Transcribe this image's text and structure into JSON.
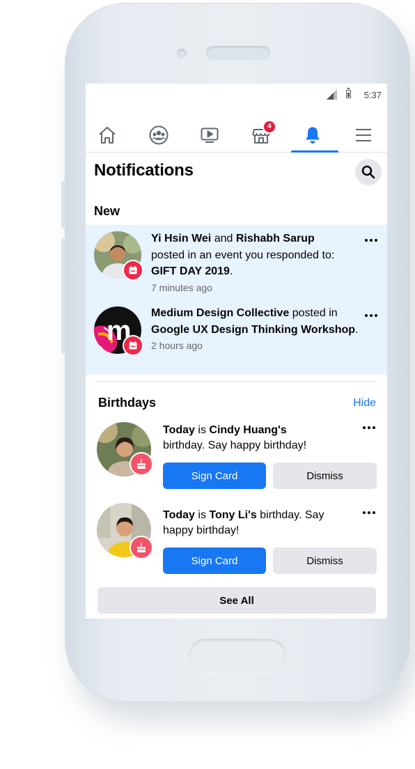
{
  "status_bar": {
    "time": "5:37"
  },
  "nav": {
    "items": [
      "home",
      "groups",
      "watch",
      "marketplace",
      "notifications",
      "menu"
    ],
    "marketplace_badge": "4",
    "active": "notifications"
  },
  "header": {
    "title": "Notifications"
  },
  "sections": {
    "new_label": "New"
  },
  "notifications": [
    {
      "actor1": "Yi Hsin Wei",
      "connector": " and ",
      "actor2": "Rishabh Sarup",
      "action": "posted in an event you responded to:",
      "target": "GIFT DAY 2019",
      "suffix": ".",
      "time": "7 minutes ago"
    },
    {
      "actor1": "Medium Design Collective",
      "action": " posted in",
      "target": "Google UX Design Thinking Workshop",
      "suffix": ".",
      "time": "2 hours ago"
    }
  ],
  "birthdays": {
    "title": "Birthdays",
    "hide_label": "Hide",
    "items": [
      {
        "today": "Today",
        "is": " is ",
        "name": "Cindy Huang's",
        "rest": "birthday. Say happy birthday!",
        "sign_label": "Sign Card",
        "dismiss_label": "Dismiss"
      },
      {
        "today": "Today",
        "is": " is ",
        "name": "Tony Li's",
        "rest": " birthday. Say happy birthday!",
        "sign_label": "Sign Card",
        "dismiss_label": "Dismiss"
      }
    ],
    "see_all_label": "See All"
  },
  "colors": {
    "accent": "#1877f2",
    "new_bg": "#e7f3ff",
    "badge_red": "#e41e3f"
  }
}
